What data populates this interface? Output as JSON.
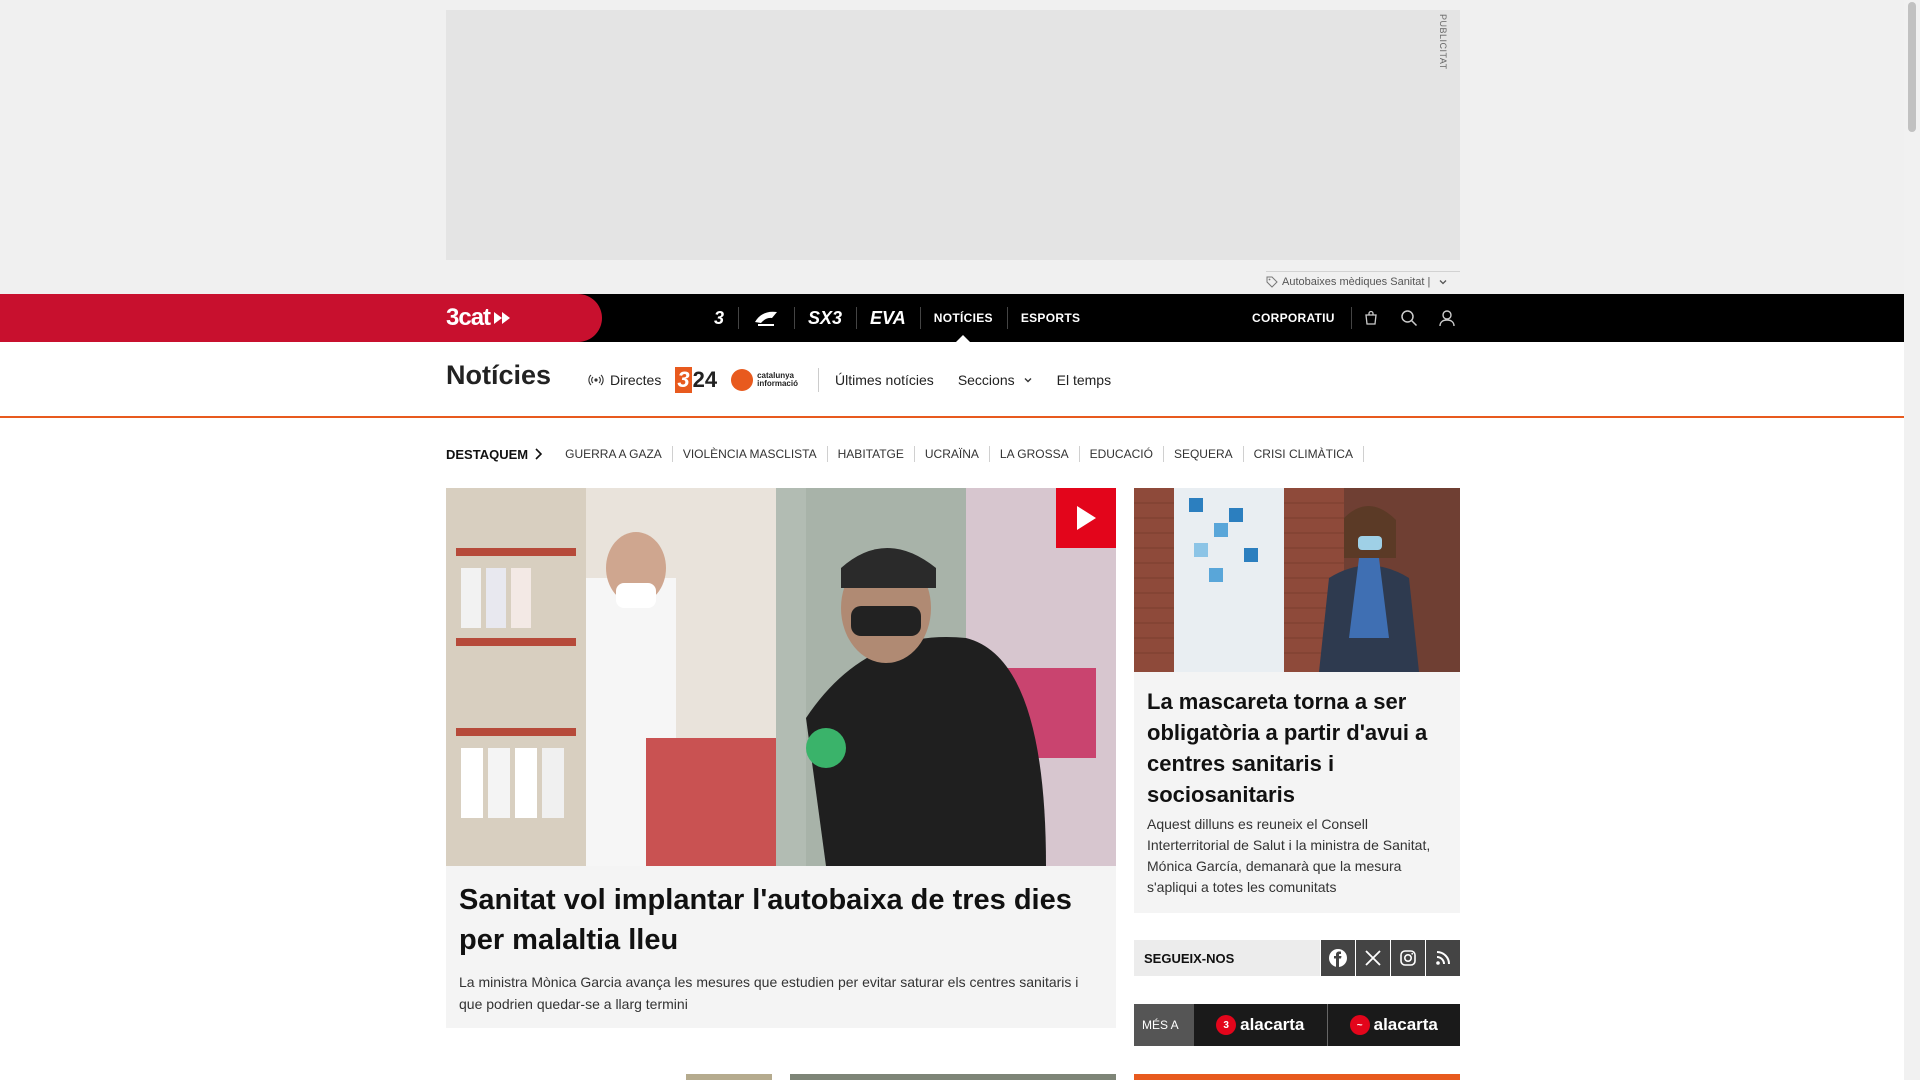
{
  "ad": {
    "label": "PUBLICITAT",
    "tag": "Autobaixes mèdiques Sanitat |"
  },
  "topnav": {
    "brand": "3cat",
    "channels": [
      {
        "label": "3",
        "icon": "tv3-icon"
      },
      {
        "label": "Cat Ràdio",
        "icon": "catradio-icon"
      },
      {
        "label": "SX3",
        "icon": "sx3-icon"
      },
      {
        "label": "EVA",
        "icon": "eva-icon"
      },
      {
        "label": "NOTÍCIES"
      },
      {
        "label": "ESPORTS"
      }
    ],
    "corporate": "CORPORATIU"
  },
  "section": {
    "title": "Notícies",
    "directes": "Directes",
    "logo_324": "24",
    "logo_324_prefix": "3",
    "logo_ci_line1": "catalunya",
    "logo_ci_line2": "informació",
    "links": [
      "Últimes notícies",
      "Seccions",
      "El temps"
    ]
  },
  "highlights": {
    "title": "DESTAQUEM",
    "items": [
      "GUERRA A GAZA",
      "VIOLÈNCIA MASCLISTA",
      "HABITATGE",
      "UCRAÏNA",
      "LA GROSSA",
      "EDUCACIÓ",
      "SEQUERA",
      "CRISI CLIMÀTICA"
    ]
  },
  "main_article": {
    "headline": "Sanitat vol implantar l'autobaixa de tres dies per malaltia lleu",
    "summary": "La ministra Mònica Garcia avança les mesures que estudien per evitar saturar els centres sanitaris i que podrien quedar-se a llarg termini"
  },
  "side_article": {
    "headline": "La mascareta torna a ser obligatòria a partir d'avui a centres sanitaris i sociosanitaris",
    "summary": "Aquest dilluns es reuneix el Consell Interterritorial de Salut i la ministra de Sanitat, Mónica García, demanarà que la mesura s'apliqui a totes les comunitats"
  },
  "follow": {
    "label": "SEGUEIX-NOS",
    "networks": [
      "facebook-icon",
      "x-icon",
      "instagram-icon",
      "rss-icon"
    ]
  },
  "alacarta": {
    "label": "MÉS A",
    "items": [
      "alacarta",
      "alacarta"
    ]
  },
  "colors": {
    "brand_red": "#c8102e",
    "accent_orange": "#e85a1e",
    "play_red": "#e3051b"
  }
}
